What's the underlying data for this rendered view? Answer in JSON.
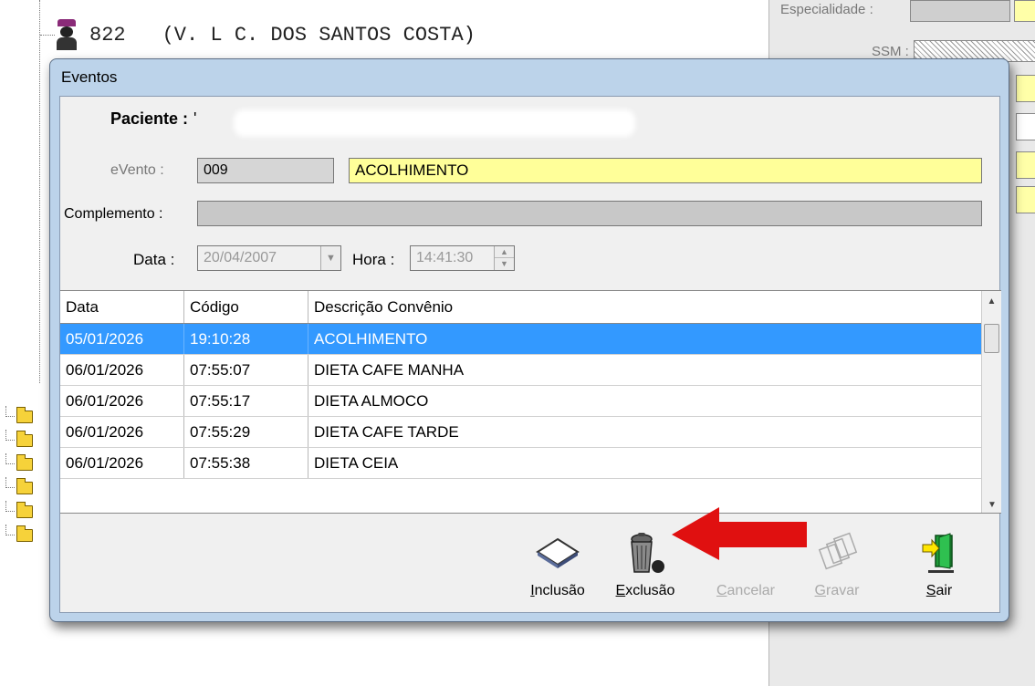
{
  "background": {
    "tree_node": {
      "id": "822",
      "text": "(V.   L C.     DOS SANTOS COSTA)"
    },
    "right_panel": {
      "especialidade_label": "Especialidade :",
      "ssm_label": "SSM :"
    }
  },
  "dialog": {
    "title": "Eventos",
    "patient": {
      "label": "Paciente :",
      "value": "'"
    },
    "evento": {
      "label": "eVento :",
      "code": "009",
      "description": "ACOLHIMENTO"
    },
    "complemento": {
      "label": "Complemento :",
      "value": ""
    },
    "data": {
      "label": "Data :",
      "value": "20/04/2007"
    },
    "hora": {
      "label": "Hora :",
      "value": "14:41:30"
    },
    "table": {
      "columns": [
        "Data",
        "Código",
        "Descrição Convênio"
      ],
      "rows": [
        {
          "data": "05/01/2026",
          "codigo": "19:10:28",
          "descricao": "ACOLHIMENTO",
          "selected": true
        },
        {
          "data": "06/01/2026",
          "codigo": "07:55:07",
          "descricao": "DIETA CAFE MANHA"
        },
        {
          "data": "06/01/2026",
          "codigo": "07:55:17",
          "descricao": "DIETA ALMOCO"
        },
        {
          "data": "06/01/2026",
          "codigo": "07:55:29",
          "descricao": "DIETA CAFE TARDE"
        },
        {
          "data": "06/01/2026",
          "codigo": "07:55:38",
          "descricao": "DIETA CEIA"
        }
      ]
    },
    "toolbar": {
      "inclusao": {
        "first": "I",
        "rest": "nclusão"
      },
      "exclusao": {
        "first": "E",
        "rest": "xclusão"
      },
      "cancelar": {
        "first": "C",
        "rest": "ancelar"
      },
      "gravar": {
        "first": "G",
        "rest": "ravar"
      },
      "sair": {
        "first": "S",
        "rest": "air"
      }
    }
  },
  "colors": {
    "selected_row": "#3399ff",
    "evento_desc_bg": "#ffff99",
    "dialog_frame": "#bcd3ea",
    "annotation_arrow": "#e01010"
  }
}
